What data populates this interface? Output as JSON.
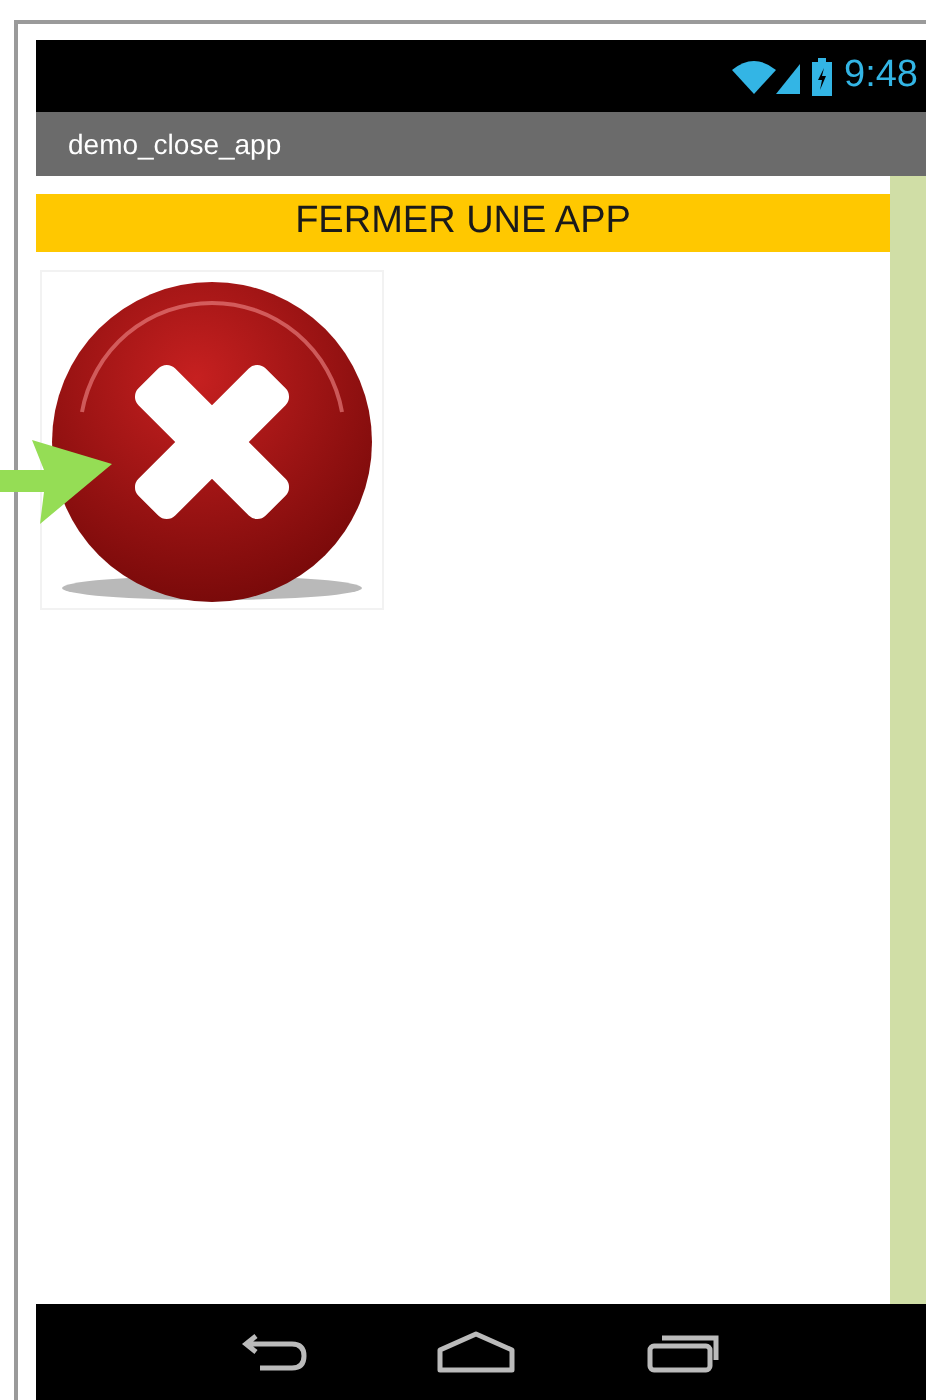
{
  "status_bar": {
    "time": "9:48"
  },
  "title_bar": {
    "title": "demo_close_app"
  },
  "banner": {
    "text": "FERMER UNE APP"
  },
  "content": {
    "image": {
      "kind": "close-button-image"
    }
  }
}
